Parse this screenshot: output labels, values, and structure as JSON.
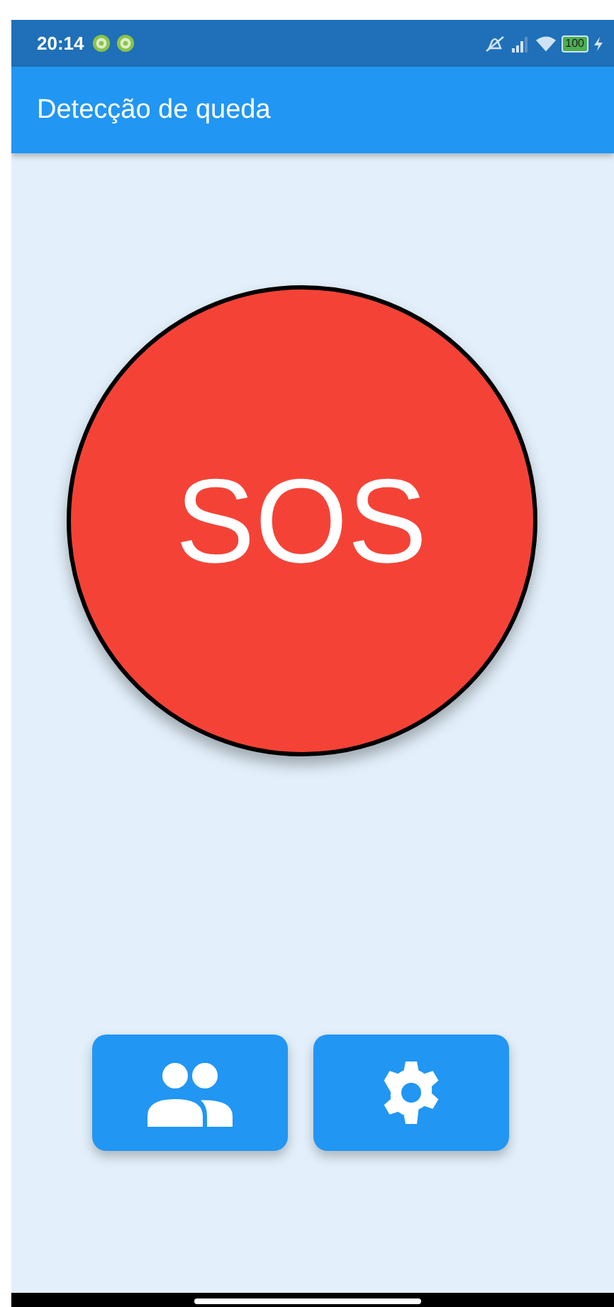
{
  "status_bar": {
    "time": "20:14",
    "battery": "100"
  },
  "app_bar": {
    "title": "Detecção de queda"
  },
  "sos_button": {
    "label": "SOS"
  },
  "action_buttons": [
    {
      "kind": "contacts"
    },
    {
      "kind": "settings"
    }
  ]
}
